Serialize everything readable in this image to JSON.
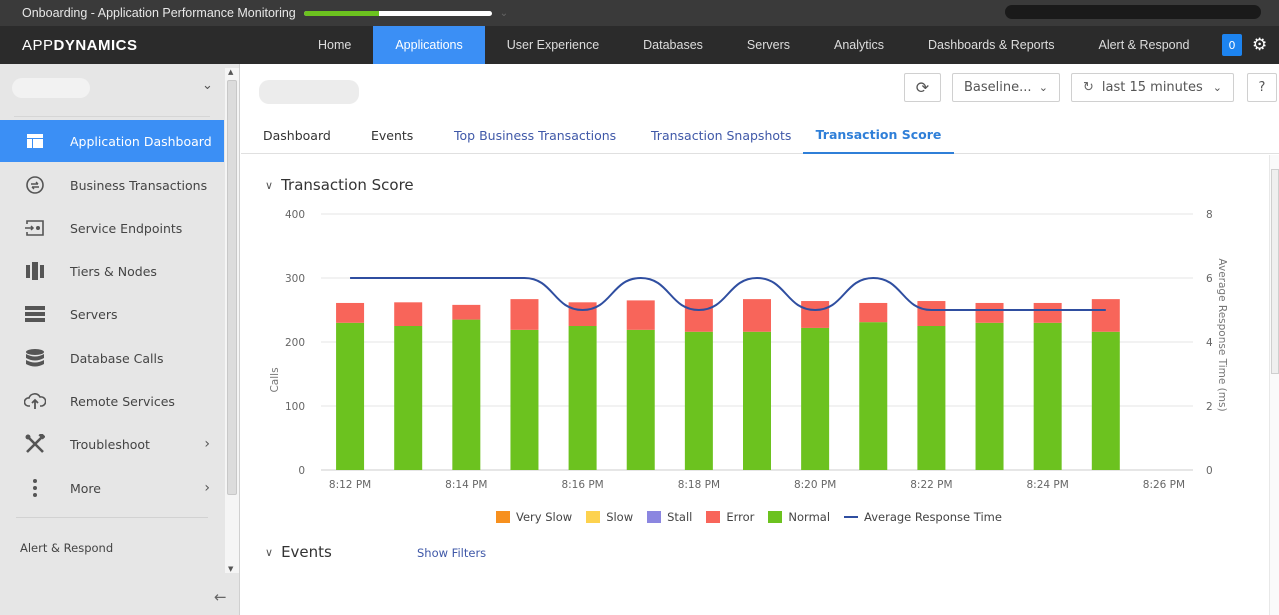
{
  "topbar": {
    "title": "Onboarding - Application Performance Monitoring",
    "progress_fraction": 0.4
  },
  "navbar": {
    "logo_light": "APP",
    "logo_bold": "DYNAMICS",
    "items": [
      {
        "label": "Home",
        "active": false
      },
      {
        "label": "Applications",
        "active": true
      },
      {
        "label": "User Experience",
        "active": false
      },
      {
        "label": "Databases",
        "active": false
      },
      {
        "label": "Servers",
        "active": false
      },
      {
        "label": "Analytics",
        "active": false
      },
      {
        "label": "Dashboards & Reports",
        "active": false
      },
      {
        "label": "Alert & Respond",
        "active": false
      }
    ],
    "notification_count": "0",
    "accent_color": "#3b8ff5"
  },
  "sidebar": {
    "items": [
      {
        "label": "Application Dashboard",
        "icon": "dashboard-icon",
        "active": true
      },
      {
        "label": "Business Transactions",
        "icon": "transactions-icon",
        "active": false
      },
      {
        "label": "Service Endpoints",
        "icon": "endpoint-icon",
        "active": false
      },
      {
        "label": "Tiers & Nodes",
        "icon": "tiers-icon",
        "active": false
      },
      {
        "label": "Servers",
        "icon": "servers-icon",
        "active": false
      },
      {
        "label": "Database Calls",
        "icon": "database-icon",
        "active": false
      },
      {
        "label": "Remote Services",
        "icon": "cloud-upload-icon",
        "active": false
      },
      {
        "label": "Troubleshoot",
        "icon": "tools-icon",
        "active": false,
        "submenu": true
      },
      {
        "label": "More",
        "icon": "more-vertical-icon",
        "active": false,
        "submenu": true
      }
    ],
    "footer_label": "Alert & Respond"
  },
  "toolbar": {
    "baseline_label": "Baseline...",
    "time_range_label": "last 15 minutes",
    "help_label": "?"
  },
  "tabs": [
    {
      "label": "Dashboard"
    },
    {
      "label": "Events"
    },
    {
      "label": "Top Business Transactions"
    },
    {
      "label": "Transaction Snapshots"
    },
    {
      "label": "Transaction Score"
    }
  ],
  "sections": {
    "transaction_score_title": "Transaction Score",
    "events_title": "Events",
    "show_filters_label": "Show Filters"
  },
  "chart_data": {
    "type": "bar",
    "stacked": true,
    "title": "Transaction Score",
    "xlabel": "",
    "ylabel": "Calls",
    "y2label": "Average Response Time (ms)",
    "ylim": [
      0,
      400
    ],
    "y2lim": [
      0,
      8
    ],
    "yticks": [
      0,
      100,
      200,
      300,
      400
    ],
    "y2ticks": [
      0,
      2,
      4,
      6,
      8
    ],
    "grid": true,
    "legend_position": "bottom",
    "xtick_labels": [
      "8:12 PM",
      "8:14 PM",
      "8:16 PM",
      "8:18 PM",
      "8:20 PM",
      "8:22 PM",
      "8:24 PM",
      "8:26 PM"
    ],
    "x_range_minutes": [
      0,
      14
    ],
    "x_minutes": [
      0,
      1,
      2,
      3,
      4,
      5,
      6,
      7,
      8,
      9,
      10,
      11,
      12,
      13
    ],
    "series": [
      {
        "name": "Very Slow",
        "color": "#f7901e",
        "values": [
          0,
          0,
          0,
          0,
          0,
          0,
          0,
          0,
          0,
          0,
          0,
          0,
          0,
          0
        ]
      },
      {
        "name": "Slow",
        "color": "#fdd24e",
        "values": [
          0,
          0,
          0,
          0,
          0,
          0,
          0,
          0,
          0,
          0,
          0,
          0,
          0,
          0
        ]
      },
      {
        "name": "Stall",
        "color": "#8b86e0",
        "values": [
          0,
          0,
          0,
          0,
          0,
          0,
          0,
          0,
          0,
          0,
          0,
          0,
          0,
          0
        ]
      },
      {
        "name": "Normal",
        "color": "#6cc21f",
        "values": [
          230,
          225,
          235,
          219,
          225,
          219,
          216,
          216,
          222,
          231,
          225,
          230,
          230,
          216
        ]
      },
      {
        "name": "Error",
        "color": "#f8655a",
        "values": [
          31,
          37,
          23,
          48,
          37,
          46,
          51,
          51,
          42,
          30,
          39,
          31,
          31,
          51
        ]
      },
      {
        "name": "Average Response Time",
        "color": "#2f4ea0",
        "type": "line",
        "axis": "right",
        "values": [
          6,
          6,
          6,
          6,
          5,
          6,
          5,
          6,
          5,
          6,
          5,
          5,
          5,
          5
        ]
      }
    ],
    "legend": [
      "Very Slow",
      "Slow",
      "Stall",
      "Error",
      "Normal",
      "Average Response Time"
    ]
  }
}
